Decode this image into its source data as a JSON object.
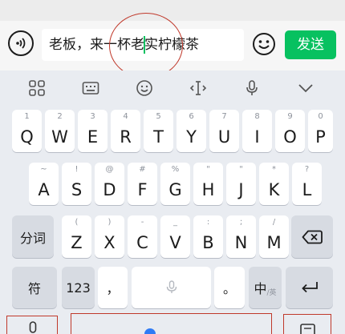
{
  "input_bar": {
    "text_before_caret": "老板，来一杯老",
    "text_after_caret": "实柠檬茶",
    "send_label": "发送"
  },
  "keyboard": {
    "row1": [
      {
        "main": "Q",
        "sub": "1"
      },
      {
        "main": "W",
        "sub": "2"
      },
      {
        "main": "E",
        "sub": "3"
      },
      {
        "main": "R",
        "sub": "4"
      },
      {
        "main": "T",
        "sub": "5"
      },
      {
        "main": "Y",
        "sub": "6"
      },
      {
        "main": "U",
        "sub": "7"
      },
      {
        "main": "I",
        "sub": "8"
      },
      {
        "main": "O",
        "sub": "9"
      },
      {
        "main": "P",
        "sub": "0"
      }
    ],
    "row2": [
      {
        "main": "A",
        "sub": "~"
      },
      {
        "main": "S",
        "sub": "!"
      },
      {
        "main": "D",
        "sub": "@"
      },
      {
        "main": "F",
        "sub": "#"
      },
      {
        "main": "G",
        "sub": "%"
      },
      {
        "main": "H",
        "sub": "\""
      },
      {
        "main": "J",
        "sub": "\""
      },
      {
        "main": "K",
        "sub": "*"
      },
      {
        "main": "L",
        "sub": "?"
      }
    ],
    "row3": [
      {
        "main": "Z",
        "sub": "("
      },
      {
        "main": "X",
        "sub": ")"
      },
      {
        "main": "C",
        "sub": "-"
      },
      {
        "main": "V",
        "sub": "_"
      },
      {
        "main": "B",
        "sub": ":"
      },
      {
        "main": "N",
        "sub": ";"
      },
      {
        "main": "M",
        "sub": "/"
      }
    ],
    "segment_label": "分词",
    "symbol_label": "符",
    "number_label": "123",
    "comma_label": "，",
    "period_label": "。",
    "lang_main": "中",
    "lang_sub": "/英"
  }
}
